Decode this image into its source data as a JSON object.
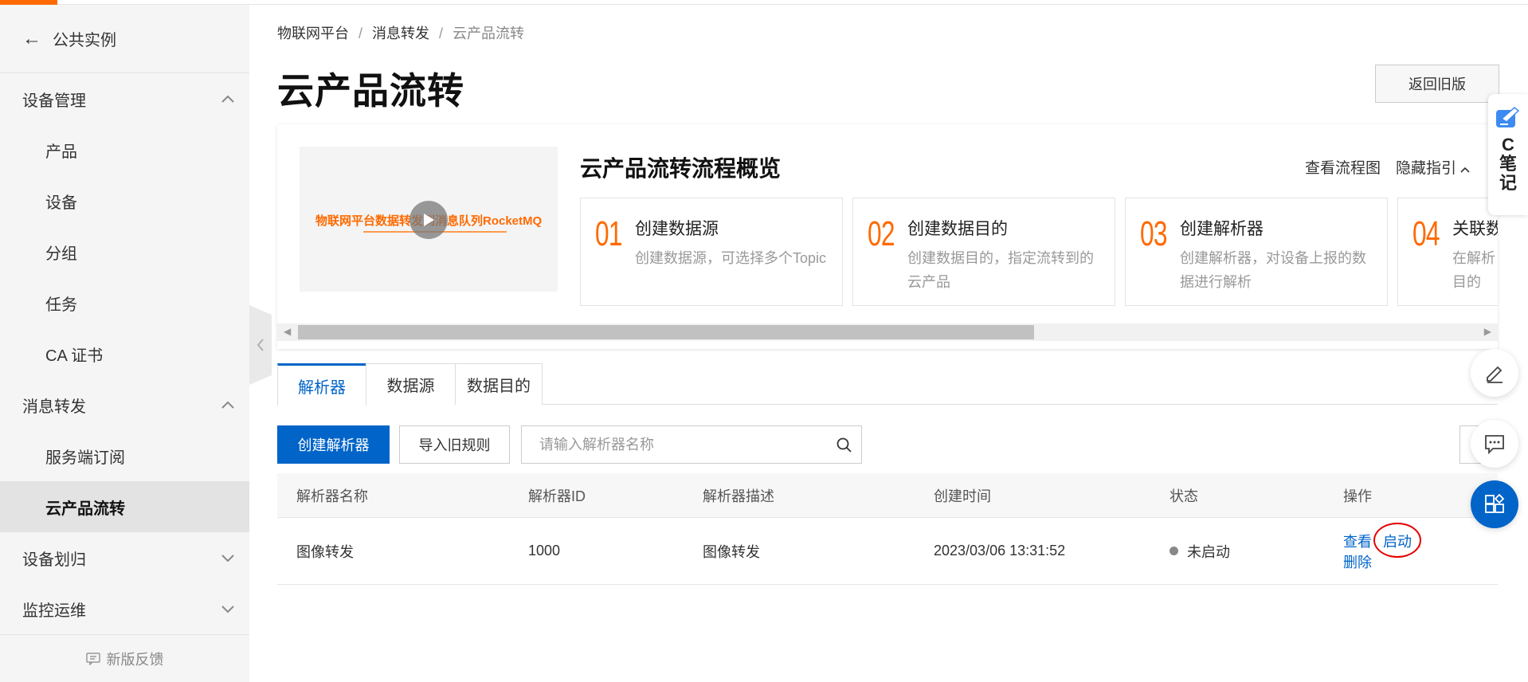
{
  "colors": {
    "accent": "#ff6a00",
    "primary": "#0064c8",
    "annotation": "#e60000"
  },
  "sidebar": {
    "back_label": "公共实例",
    "groups": [
      {
        "label": "设备管理",
        "expanded": true,
        "items": [
          {
            "label": "产品"
          },
          {
            "label": "设备"
          },
          {
            "label": "分组"
          },
          {
            "label": "任务"
          },
          {
            "label": "CA 证书"
          }
        ]
      },
      {
        "label": "消息转发",
        "expanded": true,
        "items": [
          {
            "label": "服务端订阅"
          },
          {
            "label": "云产品流转",
            "active": true
          }
        ]
      },
      {
        "label": "设备划归",
        "expanded": false,
        "items": []
      },
      {
        "label": "监控运维",
        "expanded": false,
        "items": []
      }
    ],
    "feedback_label": "新版反馈"
  },
  "breadcrumb": [
    "物联网平台",
    "消息转发",
    "云产品流转"
  ],
  "page": {
    "title": "云产品流转",
    "old_version_button": "返回旧版"
  },
  "guide": {
    "video_caption": "物联网平台数据转发到消息队列RocketMQ",
    "title": "云产品流转流程概览",
    "view_flow_link": "查看流程图",
    "hide_guide_link": "隐藏指引",
    "steps": [
      {
        "num": "01",
        "title": "创建数据源",
        "desc": "创建数据源，可选择多个Topic"
      },
      {
        "num": "02",
        "title": "创建数据目的",
        "desc": "创建数据目的，指定流转到的云产品"
      },
      {
        "num": "03",
        "title": "创建解析器",
        "desc": "创建解析器，对设备上报的数据进行解析"
      },
      {
        "num": "04",
        "title": "关联数",
        "desc": "在解析目的"
      }
    ]
  },
  "tabs": [
    {
      "label": "解析器",
      "active": true
    },
    {
      "label": "数据源",
      "active": false
    },
    {
      "label": "数据目的",
      "active": false
    }
  ],
  "toolbar": {
    "create_button": "创建解析器",
    "import_button": "导入旧规则",
    "search_placeholder": "请输入解析器名称"
  },
  "table": {
    "columns": [
      "解析器名称",
      "解析器ID",
      "解析器描述",
      "创建时间",
      "状态",
      "操作"
    ],
    "rows": [
      {
        "name": "图像转发",
        "id": "1000",
        "desc": "图像转发",
        "created": "2023/03/06 13:31:52",
        "status": "未启动",
        "actions": {
          "view": "查看",
          "start": "启动",
          "delete": "删除"
        }
      }
    ]
  },
  "floating": {
    "note_label": "C笔记",
    "icons": [
      "edit-icon",
      "chat-icon",
      "apps-icon"
    ]
  }
}
